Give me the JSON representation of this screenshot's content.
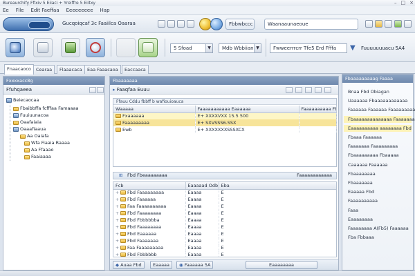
{
  "window": {
    "title": "Bureaurchify Ffixiv 5 Eiiaci + Yreiffre 5 Eiitxy",
    "controls": [
      "–",
      "□",
      "×"
    ]
  },
  "menu": [
    "Ee",
    "File",
    "Edit Faeffaa",
    "Eeeeeeeee",
    "Hap"
  ],
  "navbar": {
    "breadcrumb": "Gucqoiqcaf 3c Faaiilca Oaaraa",
    "path_segment": "Fbbwbccc",
    "search_value": "Waanaaunaeoue"
  },
  "toolbar": {
    "combo1": "5 Sfoad",
    "combo2": "Mdb Wbbiiano",
    "combo3": "Fwweerrrcrr Tfe5 Erd Ffffa",
    "right_label": "Fuuuuuuuacu 5A4"
  },
  "tabs": [
    "Fnaacaoco",
    "Cearaa",
    "Flaaacaca",
    "Eaa Faaacaoa",
    "Eaccaaca"
  ],
  "left_panel": {
    "header": "Fxxxxacc8g",
    "subbar_label": "Ffuhqaeea",
    "root_label": "Beiecaocaa",
    "tree": [
      {
        "label": "Fbaibbffa fcfffaa Famaaaa",
        "indent": 1
      },
      {
        "label": "Fuuiuunacoa",
        "indent": 1
      },
      {
        "label": "Oaafaiaia",
        "indent": 1
      },
      {
        "label": "Oaaafiaaua",
        "indent": 1
      },
      {
        "label": "Aa Oaiafa",
        "indent": 2
      },
      {
        "label": "Wfa Fiaaia Raaaa",
        "indent": 2
      },
      {
        "label": "Aa Ffaaao",
        "indent": 2
      },
      {
        "label": "Faaiaaaa",
        "indent": 2
      }
    ]
  },
  "center": {
    "header": "Fbaaaaaaa",
    "subbar_label": "Faaqfaa Euuu",
    "top_table": {
      "caption": "Ffauu Cddu fbbff b wafiouioauca",
      "columns": [
        "Waaaaa",
        "Faaaaaaaaaaa Eaaaaaa",
        "Faaaaaaaaaa Fbbbbbu"
      ],
      "rows": [
        {
          "name": "Fxaaaaaa",
          "mid": "E+ XXXXVXX 15.5 500",
          "right": "",
          "style": "hl"
        },
        {
          "name": "Faaaaaaaaa",
          "mid": "E+ SXVSSS6.SSX",
          "right": "",
          "style": "sel"
        },
        {
          "name": "Ewb",
          "mid": "E+ XXXXXXXSSSXCX",
          "right": "",
          "style": ""
        }
      ]
    },
    "divider_left": "Fbd Fbeaaaaaaaa",
    "divider_right": "Faaaaaaaaaaaa",
    "bottom_table": {
      "columns": [
        "Fcb",
        "Eaaaaad Odb",
        "Eba"
      ],
      "rows": [
        {
          "name": "Fbd Faaaaaaaaa",
          "mid": "Eaaaa",
          "right": "E"
        },
        {
          "name": "Fbd Faaaaaa",
          "mid": "Eaaaa",
          "right": "E"
        },
        {
          "name": "Faa Faaaaaaaaaa",
          "mid": "Eaaaa",
          "right": "E"
        },
        {
          "name": "Fbd Faaaaaaaa",
          "mid": "Eaaaa",
          "right": "E"
        },
        {
          "name": "Fbd Fbbbbbba",
          "mid": "Eaaaa",
          "right": "E"
        },
        {
          "name": "Fbd Faaaaaaaa",
          "mid": "Eaaaa",
          "right": "E"
        },
        {
          "name": "Fbd Eaaaaaa",
          "mid": "Eaaaa",
          "right": "E"
        },
        {
          "name": "Fbd Faaaaaaa",
          "mid": "Eaaaa",
          "right": "E"
        },
        {
          "name": "Faa Faaaaaaaaa",
          "mid": "Eaaaa",
          "right": "E"
        },
        {
          "name": "Fbd Fbbbbbb",
          "mid": "Eaaaa",
          "right": "E"
        }
      ]
    },
    "bottom_buttons": [
      "Auaa Fbd",
      "Eaaaaa",
      "Faaaaaa 5A",
      "Eaaaaaaaa"
    ]
  },
  "right_panel": {
    "header": "Fbaaaaaaaaag Faaaa",
    "items": [
      {
        "label": "Bnaa Fbd Obiagan",
        "hl": false
      },
      {
        "label": "Uaaaaaa Fbaaaaaaaaaaaa",
        "hl": false
      },
      {
        "label": "Faaaaaa Faaaaaa Faaaaaaaaa",
        "hl": false
      },
      {
        "label": "Fbaaaaaaaaaaaaaa Faaaaaaa",
        "hl": true
      },
      {
        "label": "Eaaaaaaaaaa aaaaaaaa Fbd",
        "hl": true
      },
      {
        "label": "Fbaaa Faaaaaa",
        "hl": false
      },
      {
        "label": "Faaaaaaa Faaaaaaaaa",
        "hl": false
      },
      {
        "label": "Fbaaaaaaaaa Fbaaaaa",
        "hl": false
      },
      {
        "label": "Caaaaaa Faaaaaa",
        "hl": false
      },
      {
        "label": "Fbaaaaaaaa",
        "hl": false
      },
      {
        "label": "Fbaaaaaaa",
        "hl": false
      },
      {
        "label": "Eaaaaa Fbd",
        "hl": false
      },
      {
        "label": "Faaaaaaaaaa",
        "hl": false
      },
      {
        "label": "Faaa",
        "hl": false
      },
      {
        "label": "Eaaaaaaaa",
        "hl": false
      },
      {
        "label": "Faaaaaaaa A(Fb5) Faaaaaa",
        "hl": false
      },
      {
        "label": "Fba Fbbaaa",
        "hl": false
      }
    ]
  }
}
